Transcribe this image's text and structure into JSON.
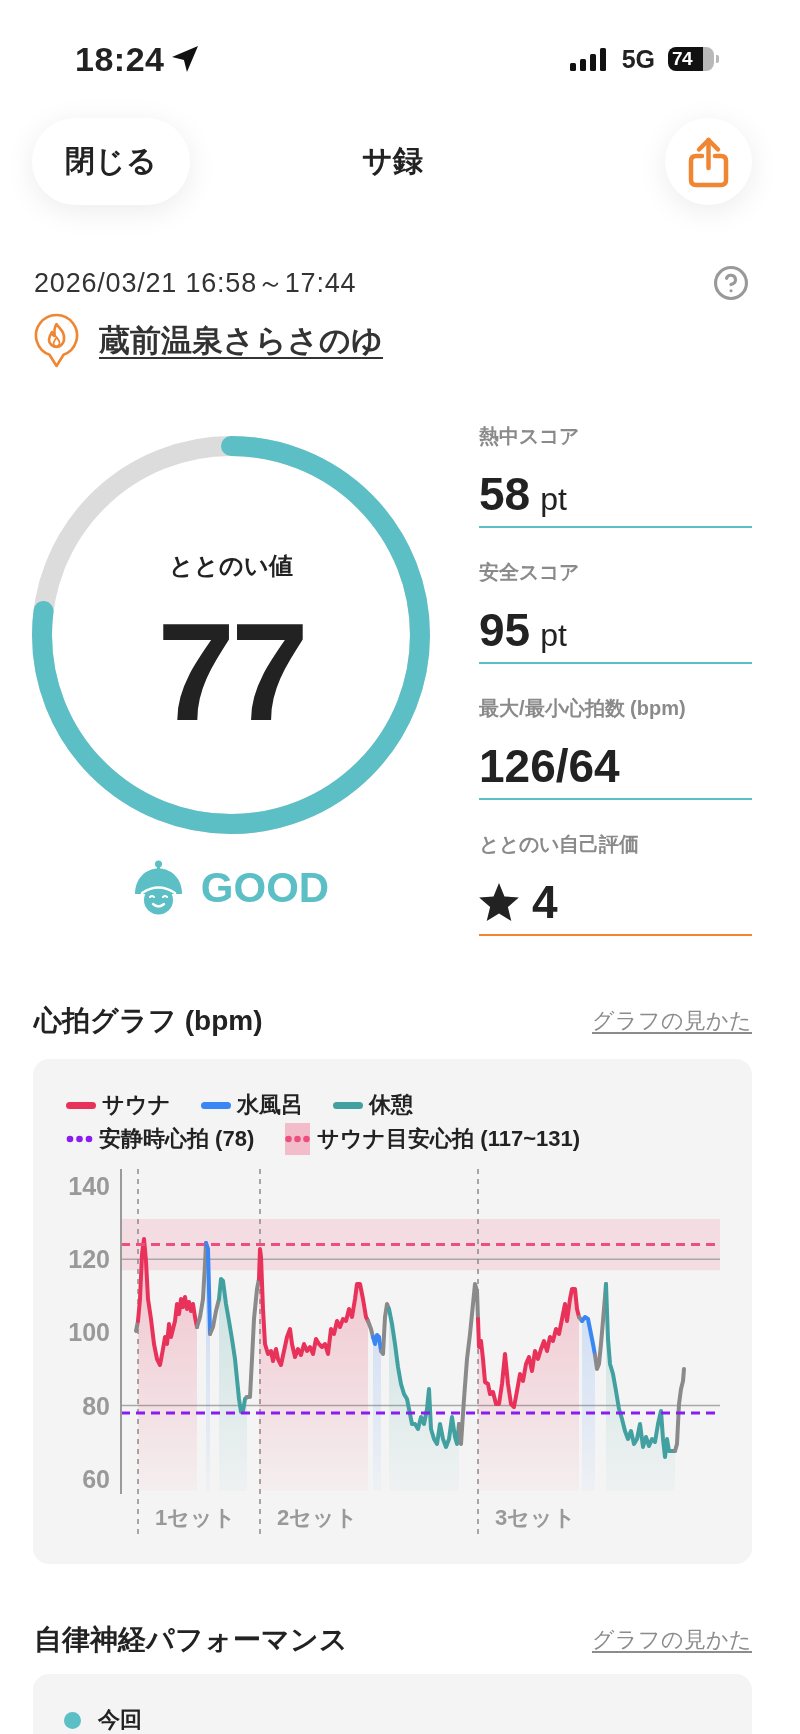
{
  "status_bar": {
    "time": "18:24",
    "network": "5G",
    "battery": "74"
  },
  "nav": {
    "close_button": "閉じる",
    "title": "サ録"
  },
  "session": {
    "datetime": "2026/03/21 16:58～17:44",
    "facility": "蔵前温泉さらさのゆ"
  },
  "totonoi": {
    "label": "ととのい値",
    "value": "77",
    "level": 0.77,
    "rating": "GOOD"
  },
  "metrics": [
    {
      "kind": "score",
      "label": "熱中スコア",
      "value": "58",
      "unit": "pt"
    },
    {
      "kind": "score",
      "label": "安全スコア",
      "value": "95",
      "unit": "pt"
    },
    {
      "kind": "heart_rate",
      "label": "最大/最小心拍数 (bpm)",
      "value": "126/64"
    },
    {
      "kind": "self_rating",
      "label": "ととのい自己評価",
      "value": "4"
    }
  ],
  "heart_rate_chart": {
    "title": "心拍グラフ (bpm)",
    "guide_link": "グラフの見かた",
    "legend_rows": [
      {
        "items": [
          {
            "kind": "line",
            "label": "サウナ",
            "color": "#e8325a"
          },
          {
            "kind": "line",
            "label": "水風呂",
            "color": "#3a86f5"
          },
          {
            "kind": "line",
            "label": "休憩",
            "color": "#42a0a0"
          }
        ]
      },
      {
        "items": [
          {
            "kind": "dotted",
            "label": "安静時心拍 (78)",
            "color": "#8a1cf0"
          },
          {
            "kind": "band",
            "label": "サウナ目安心拍 (117~131)",
            "color": "#f2bccb"
          }
        ]
      }
    ],
    "y_axis_labels": [
      "140",
      "120",
      "100",
      "80",
      "60"
    ],
    "set_labels": [
      "1セット",
      "2セット",
      "3セット"
    ]
  },
  "autonomic_performance": {
    "title": "自律神経パフォーマンス",
    "guide_link": "グラフの見かた",
    "legend": [
      {
        "label": "今回",
        "color": "#5bbfc5"
      }
    ]
  }
}
